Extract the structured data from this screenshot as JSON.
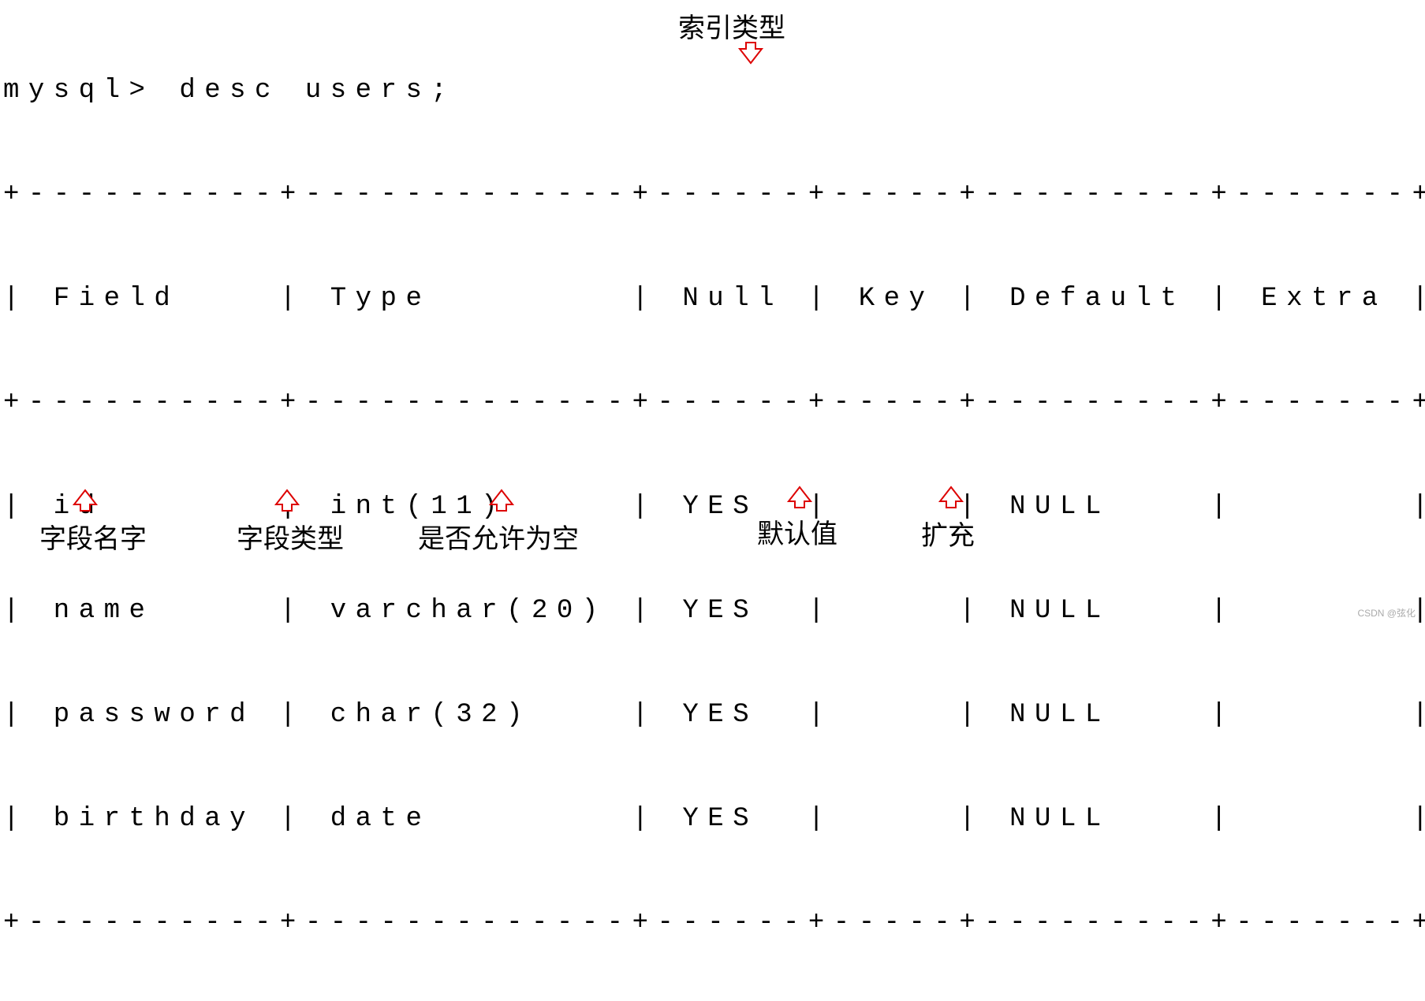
{
  "prompt": "mysql> desc users;",
  "top_annotation": "索引类型",
  "border_top": "+----------+-------------+------+-----+---------+-------+",
  "header_row": "| Field    | Type        | Null | Key | Default | Extra |",
  "border_mid": "+----------+-------------+------+-----+---------+-------+",
  "rows": [
    {
      "field": "id",
      "type": "int(11)",
      "null": "YES",
      "key": "",
      "default": "NULL",
      "extra": ""
    },
    {
      "field": "name",
      "type": "varchar(20)",
      "null": "YES",
      "key": "",
      "default": "NULL",
      "extra": ""
    },
    {
      "field": "password",
      "type": "char(32)",
      "null": "YES",
      "key": "",
      "default": "NULL",
      "extra": ""
    },
    {
      "field": "birthday",
      "type": "date",
      "null": "YES",
      "key": "",
      "default": "NULL",
      "extra": ""
    }
  ],
  "row_lines": [
    "| id       | int(11)     | YES  |     | NULL    |       |",
    "| name     | varchar(20) | YES  |     | NULL    |       |",
    "| password | char(32)    | YES  |     | NULL    |       |",
    "| birthday | date        | YES  |     | NULL    |       |"
  ],
  "border_bot": "+----------+-------------+------+-----+---------+-------+",
  "bottom_annotations": {
    "field_label": "字段名字",
    "type_label": "字段类型",
    "null_label": "是否允许为空",
    "default_label": "默认值",
    "extra_label": "扩充"
  },
  "watermark": "CSDN @弦化"
}
